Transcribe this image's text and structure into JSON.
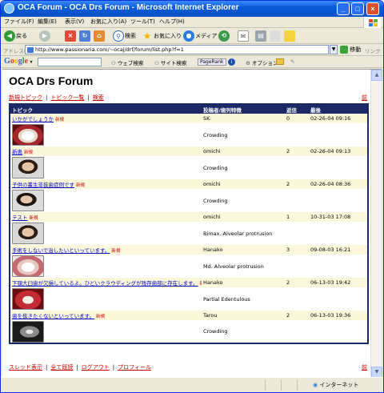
{
  "window": {
    "title": "OCA Forum - OCA Drs Forum - Microsoft Internet Explorer",
    "min_label": "_",
    "max_label": "□",
    "close_label": "×"
  },
  "menu": [
    "ファイル(F)",
    "編集(E)",
    "表示(V)",
    "お気に入り(A)",
    "ツール(T)",
    "ヘルプ(H)"
  ],
  "toolbar": {
    "back_label": "戻る",
    "search_label": "検索",
    "favorites_label": "お気に入り",
    "media_label": "メディア"
  },
  "address": {
    "label": "アドレス(D)",
    "url": "http://www.passionaria.com/~ocaj/drf/forum/list.php?f=1",
    "go_label": "移動",
    "links_label": "リンク"
  },
  "google_bar": {
    "logo": "Google",
    "web_search": "ウェブ検索",
    "site_search": "サイト検索",
    "pagerank": "PageRank",
    "options": "オプション"
  },
  "page": {
    "title": "OCA Drs Forum",
    "top_links": [
      "新規トピック",
      "トピック一覧",
      "検索"
    ],
    "top_right": "前",
    "bottom_links": [
      "スレッド表示",
      "全て既読",
      "ログアウト",
      "プロフィール"
    ],
    "bottom_right": "前"
  },
  "table": {
    "headers": [
      "トピック",
      "投稿者/歯列特徴",
      "返信",
      "最後"
    ],
    "new_badge": "新規",
    "rows": [
      {
        "topic": "いかがでしょうか",
        "new": true,
        "author": "SK",
        "replies": "0",
        "last": "02-26-04 09:16",
        "feature": "Crowding",
        "thumb": "teeth"
      },
      {
        "topic": "新患",
        "new": true,
        "author": "omichi",
        "replies": "2",
        "last": "02-26-04 09:13",
        "feature": "Crowding",
        "thumb": "face"
      },
      {
        "topic": "子供の叢生非抜歯症例です",
        "new": true,
        "author": "omichi",
        "replies": "2",
        "last": "02-26-04 08:36",
        "feature": "Crowding",
        "thumb": "profile"
      },
      {
        "topic": "テスト",
        "new": true,
        "author": "omichi",
        "replies": "1",
        "last": "10-31-03 17:08",
        "feature": "Bimax. Alveolar protrusion",
        "thumb": "face"
      },
      {
        "topic": "手術をしないで治したいといっています。",
        "new": true,
        "author": "Hanako",
        "replies": "3",
        "last": "09-08-03 16:21",
        "feature": "Md. Alveolar protrusion",
        "thumb": "teeth-light"
      },
      {
        "topic": "下顎大臼歯が欠損しているよ。ひどいクラウディングが残存歯部に存在します。",
        "new": true,
        "author": "Hanako",
        "replies": "2",
        "last": "06-13-03 19:42",
        "feature": "Partial Edentulous",
        "thumb": "teeth-red"
      },
      {
        "topic": "歯を抜きたくないといっています。",
        "new": true,
        "author": "Tarou",
        "replies": "2",
        "last": "06-13-03 19:36",
        "feature": "Crowding",
        "thumb": "xray"
      }
    ]
  },
  "status": {
    "zone": "インターネット"
  }
}
